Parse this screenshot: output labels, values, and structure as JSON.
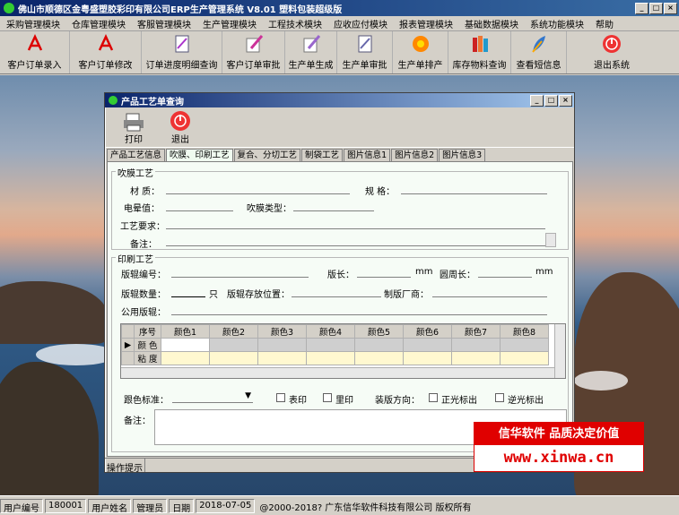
{
  "app_title": "佛山市顺德区金粤盛塑胶彩印有限公司ERP生产管理系统   V8.01  塑料包装超级版",
  "window_buttons": [
    "_",
    "□",
    "×"
  ],
  "menu": [
    "采购管理模块",
    "仓库管理模块",
    "客服管理模块",
    "生产管理模块",
    "工程技术模块",
    "应收应付模块",
    "报表管理模块",
    "基础数据模块",
    "系统功能模块",
    "帮助"
  ],
  "toolbar": [
    {
      "label": "客户订单录入",
      "icon": "pdf-icon"
    },
    {
      "label": "客户订单修改",
      "icon": "pdf-icon"
    },
    {
      "label": "订单进度明细查询",
      "icon": "document-icon"
    },
    {
      "label": "客户订单审批",
      "icon": "quill-icon"
    },
    {
      "label": "生产单生成",
      "icon": "quill-icon"
    },
    {
      "label": "生产单审批",
      "icon": "document-icon"
    },
    {
      "label": "生产单排产",
      "icon": "flower-icon"
    },
    {
      "label": "库存物料查询",
      "icon": "books-icon"
    },
    {
      "label": "查看短信息",
      "icon": "feather-icon"
    },
    {
      "label": "退出系统",
      "icon": "exit-icon"
    }
  ],
  "dialog": {
    "title": "产品工艺单查询",
    "buttons": [
      "_",
      "□",
      "×"
    ],
    "tools": [
      {
        "label": "打印",
        "icon": "printer-icon"
      },
      {
        "label": "退出",
        "icon": "exit-icon"
      }
    ],
    "tabs": [
      "产品工艺信息",
      "吹膜、印刷工艺",
      "复合、分切工艺",
      "制袋工艺",
      "图片信息1",
      "图片信息2",
      "图片信息3"
    ],
    "blown": {
      "title": "吹膜工艺",
      "material": "材 质：",
      "spec": "规 格：",
      "corona": "电晕值：",
      "blow_type": "吹膜类型：",
      "requirement": "工艺要求：",
      "remark": "备注："
    },
    "print": {
      "title": "印刷工艺",
      "plate_no": "版辊编号：",
      "plate_len": "版长：",
      "mm1": "mm",
      "circ": "圆周长：",
      "mm2": "mm",
      "plate_qty": "版辊数量：",
      "unit": "只",
      "plate_loc": "版辊存放位置：",
      "maker": "制版厂商：",
      "common": "公用版辊："
    },
    "grid": {
      "headers": [
        "序号",
        "颜色1",
        "颜色2",
        "颜色3",
        "颜色4",
        "颜色5",
        "颜色6",
        "颜色7",
        "颜色8"
      ],
      "rows": [
        "颜 色",
        "粘 度"
      ]
    },
    "options": {
      "color_std": "跟色标准：",
      "surface": "表印",
      "inner": "里印",
      "direction": "装版方向：",
      "forward": "正光标出",
      "reverse": "逆光标出",
      "remark": "备注："
    },
    "status": "操作提示"
  },
  "statusbar": [
    "用户编号",
    "180001",
    "用户姓名",
    "管理员",
    "日期",
    "2018-07-05",
    "@2000-2018?   广东信华软件科技有限公司   版权所有"
  ],
  "watermark": {
    "line1": "信华软件  品质决定价值",
    "line2": "www.xinwa.cn"
  }
}
